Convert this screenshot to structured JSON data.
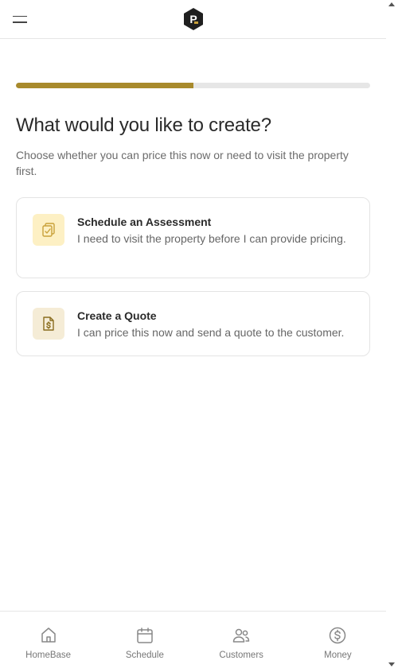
{
  "header": {
    "menu_icon": "hamburger-menu-icon",
    "logo_icon": "p-brand-logo",
    "logo_letter": "P"
  },
  "progress": {
    "percent": 50,
    "fill_color": "#a88a2c",
    "track_color": "#e6e6e6"
  },
  "page": {
    "title": "What would you like to create?",
    "subtitle": "Choose whether you can price this now or need to visit the property first."
  },
  "options": [
    {
      "icon": "clipboard-check-icon",
      "title": "Schedule an Assessment",
      "description": "I need to visit the property before I can provide pricing."
    },
    {
      "icon": "dollar-document-icon",
      "title": "Create a Quote",
      "description": "I can price this now and send a quote to the customer."
    }
  ],
  "bottom_nav": [
    {
      "icon": "home-icon",
      "label": "HomeBase"
    },
    {
      "icon": "calendar-icon",
      "label": "Schedule"
    },
    {
      "icon": "users-icon",
      "label": "Customers"
    },
    {
      "icon": "dollar-circle-icon",
      "label": "Money"
    }
  ],
  "colors": {
    "accent": "#a88a2c",
    "icon_gold": "#c9a13a",
    "nav_icon": "#888888"
  }
}
